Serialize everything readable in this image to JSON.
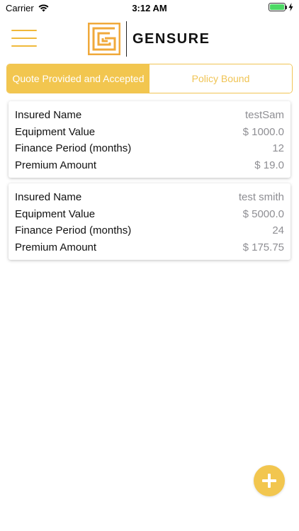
{
  "status_bar": {
    "carrier": "Carrier",
    "time": "3:12 AM",
    "battery_level": 1.0
  },
  "header": {
    "brand": "GENSURE",
    "menu_icon": "hamburger-icon"
  },
  "tabs": [
    {
      "label": "Quote Provided and Accepted",
      "active": true
    },
    {
      "label": "Policy Bound",
      "active": false
    }
  ],
  "cards": [
    {
      "rows": [
        {
          "label": "Insured Name",
          "value": "testSam"
        },
        {
          "label": "Equipment Value",
          "value": "$ 1000.0"
        },
        {
          "label": "Finance Period (months)",
          "value": "12"
        },
        {
          "label": "Premium Amount",
          "value": "$ 19.0"
        }
      ]
    },
    {
      "rows": [
        {
          "label": "Insured Name",
          "value": "test smith"
        },
        {
          "label": "Equipment Value",
          "value": "$ 5000.0"
        },
        {
          "label": "Finance Period (months)",
          "value": "24"
        },
        {
          "label": "Premium Amount",
          "value": "$ 175.75"
        }
      ]
    }
  ],
  "fab": {
    "icon": "plus-icon"
  },
  "colors": {
    "accent": "#f2c64f",
    "accent_border": "#f0c454",
    "value_text": "#8e8e93",
    "battery": "#4cd964"
  }
}
